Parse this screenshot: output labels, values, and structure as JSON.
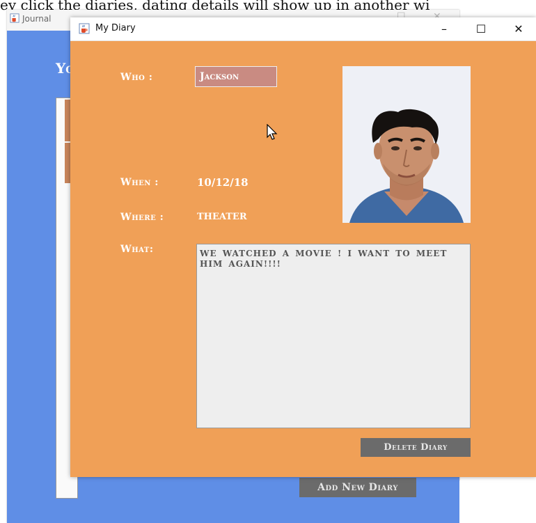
{
  "caption": "ey click the diaries, dating details will show up in another wi",
  "background_window": {
    "title": "Journal",
    "label": "Yo",
    "add_button": "Add New Diary",
    "bg_color": "#5f8ee6"
  },
  "window": {
    "title": "My Diary",
    "minimize": "–",
    "maximize": "☐",
    "close": "✕",
    "bg_color": "#f0a057"
  },
  "form": {
    "who_label": "Who :",
    "who_value": "Jackson",
    "when_label": "When :",
    "when_value": "10/12/18",
    "where_label": "Where :",
    "where_value": "THEATER",
    "what_label": "What:",
    "what_value": "WE WATCHED A MOVIE ! I WANT TO MEET HIM AGAIN!!!!"
  },
  "buttons": {
    "delete": "Delete Diary"
  },
  "icons": {
    "app": "java-coffee-icon",
    "cursor": "mouse-pointer-icon",
    "photo": "profile-photo"
  }
}
